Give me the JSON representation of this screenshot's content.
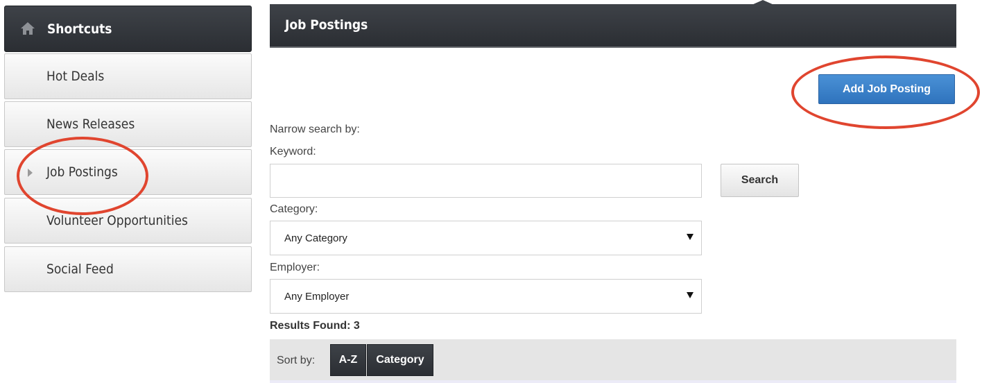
{
  "sidebar": {
    "header": "Shortcuts",
    "items": [
      {
        "label": "Hot Deals"
      },
      {
        "label": "News Releases"
      },
      {
        "label": "Job Postings",
        "active": true
      },
      {
        "label": "Volunteer Opportunities"
      },
      {
        "label": "Social Feed"
      }
    ]
  },
  "main": {
    "title": "Job Postings",
    "add_button": "Add Job Posting",
    "narrow_label": "Narrow search by:",
    "keyword_label": "Keyword:",
    "keyword_value": "",
    "search_button": "Search",
    "category_label": "Category:",
    "category_value": "Any Category",
    "employer_label": "Employer:",
    "employer_value": "Any Employer",
    "results_label": "Results Found: 3",
    "sort_label": "Sort by:",
    "sort_options": [
      "A-Z",
      "Category"
    ]
  },
  "colors": {
    "header_dark": "#2f3237",
    "primary_blue": "#3a7fc8",
    "annotation_red": "#e0452f"
  },
  "icons": {
    "home": "home-icon",
    "item_arrow": "caret-right-icon",
    "select_caret": "caret-down-icon"
  }
}
